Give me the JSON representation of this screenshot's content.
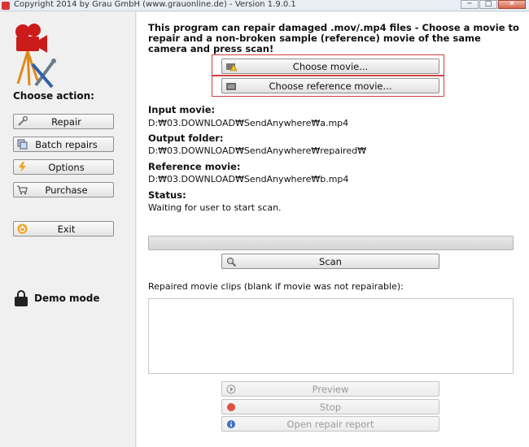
{
  "window": {
    "title": "Copyright 2014 by Grau GmbH (www.grauonline.de) - Version 1.9.0.1",
    "controls": {
      "minimize": "─",
      "maximize": "□",
      "close": "✕"
    }
  },
  "sidebar": {
    "heading": "Choose action:",
    "buttons": {
      "repair": "Repair",
      "batch": "Batch repairs",
      "options": "Options",
      "purchase": "Purchase",
      "exit": "Exit"
    },
    "demo_mode": "Demo mode"
  },
  "main": {
    "intro": "This program can repair damaged .mov/.mp4 files - Choose a movie to repair and a non-broken sample (reference) movie of the same camera and press scan!",
    "choose_movie_label": "Choose movie...",
    "choose_reference_label": "Choose reference movie...",
    "input_movie": {
      "label": "Input movie:",
      "value": "D:₩03.DOWNLOAD₩SendAnywhere₩a.mp4"
    },
    "output_folder": {
      "label": "Output folder:",
      "value": "D:₩03.DOWNLOAD₩SendAnywhere₩repaired₩"
    },
    "reference_movie": {
      "label": "Reference movie:",
      "value": "D:₩03.DOWNLOAD₩SendAnywhere₩b.mp4"
    },
    "status": {
      "label": "Status:",
      "value": "Waiting for user to start scan."
    },
    "progress": 0,
    "scan_label": "Scan",
    "results_label": "Repaired movie clips (blank if movie was not repairable):",
    "preview_label": "Preview",
    "stop_label": "Stop",
    "report_label": "Open repair report"
  },
  "colors": {
    "highlight": "#d04040",
    "accent_orange": "#f0a020",
    "logo_red": "#cc1b1b"
  }
}
